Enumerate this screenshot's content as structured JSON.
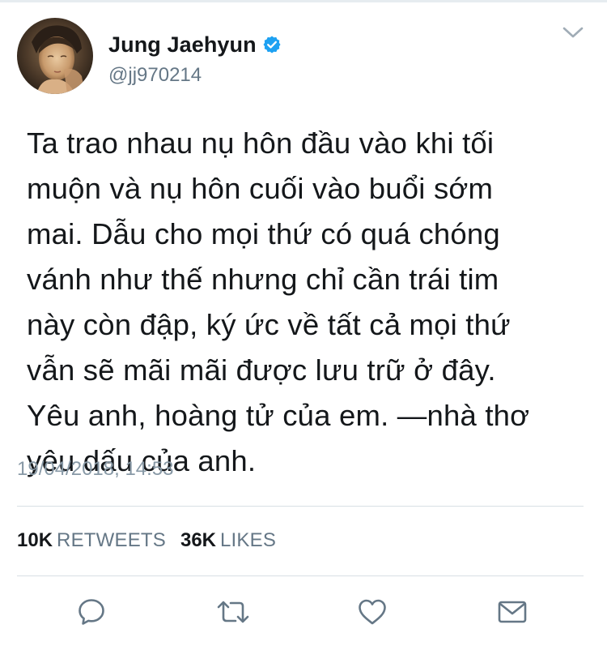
{
  "tweet": {
    "author": {
      "display_name": "Jung Jaehyun",
      "handle": "@jj970214",
      "verified": true,
      "verified_color": "#1da1f2"
    },
    "text_lines": [
      "Ta trao nhau nụ hôn đầu vào khi tối",
      "muộn và nụ hôn cuối vào buổi sớm",
      "mai. Dẫu cho mọi thứ có quá chóng",
      "vánh như thế nhưng chỉ cần trái tim",
      "này còn đập, ký ức về tất cả mọi thứ",
      "vẫn sẽ mãi mãi được lưu trữ ở đây.",
      "Yêu anh, hoàng tử của em. —nhà thơ",
      "yêu dấu của anh."
    ],
    "timestamp": "19/04/2018, 14:53",
    "stats": {
      "retweets_count": "10K",
      "retweets_label": "RETWEETS",
      "likes_count": "36K",
      "likes_label": "LIKES"
    }
  },
  "icons": {
    "menu": "chevron-down-icon",
    "reply": "speech-bubble-icon",
    "retweet": "retweet-arrows-icon",
    "like": "heart-icon",
    "message": "envelope-icon"
  },
  "colors": {
    "text": "#14171a",
    "secondary_text": "#657786",
    "timestamp": "#8899a6",
    "icon": "#657786",
    "divider": "#d8dfe5"
  }
}
